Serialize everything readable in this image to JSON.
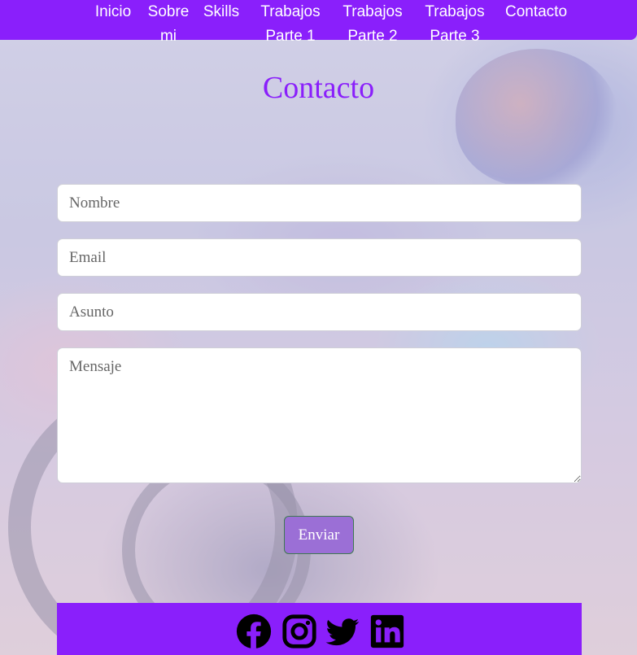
{
  "nav": {
    "items": [
      {
        "label_line1": "Inicio",
        "label_line2": ""
      },
      {
        "label_line1": "Sobre",
        "label_line2": "mi"
      },
      {
        "label_line1": "Skills",
        "label_line2": ""
      },
      {
        "label_line1": "Trabajos",
        "label_line2": "Parte 1"
      },
      {
        "label_line1": "Trabajos",
        "label_line2": "Parte 2"
      },
      {
        "label_line1": "Trabajos",
        "label_line2": "Parte 3"
      },
      {
        "label_line1": "Contacto",
        "label_line2": ""
      }
    ]
  },
  "page": {
    "title": "Contacto"
  },
  "form": {
    "nombre_placeholder": "Nombre",
    "email_placeholder": "Email",
    "asunto_placeholder": "Asunto",
    "mensaje_placeholder": "Mensaje",
    "submit_label": "Enviar"
  },
  "footer": {
    "social_icons": [
      "facebook-icon",
      "instagram-icon",
      "twitter-icon",
      "linkedin-icon"
    ]
  },
  "colors": {
    "accent": "#8a1ffb",
    "button": "#9b6fd6",
    "icon": "#000000"
  }
}
